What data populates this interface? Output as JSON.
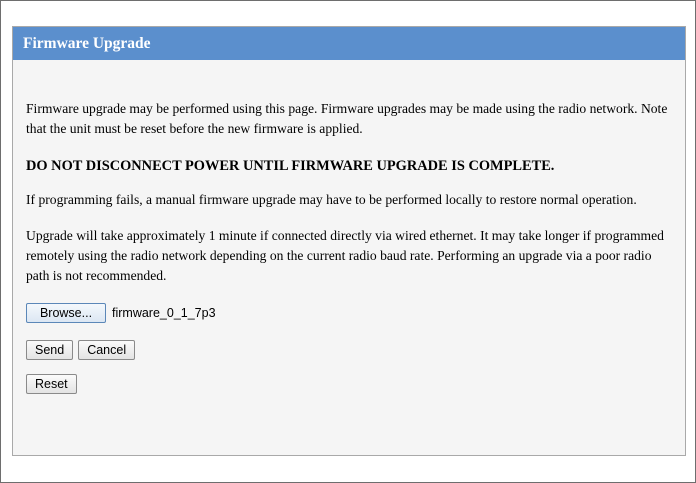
{
  "panel": {
    "title": "Firmware Upgrade"
  },
  "content": {
    "intro": "Firmware upgrade may be performed using this page. Firmware upgrades may be made using the radio network. Note that the unit must be reset before the new firmware is applied.",
    "warning": "DO NOT DISCONNECT POWER UNTIL FIRMWARE UPGRADE IS COMPLETE.",
    "failure_note": "If programming fails, a manual firmware upgrade may have to be performed locally to restore normal operation.",
    "timing_note": "Upgrade will take approximately 1 minute if connected directly via wired ethernet. It may take longer if programmed remotely using the radio network depending on the current radio baud rate. Performing an upgrade via a poor radio path is not recommended."
  },
  "file_input": {
    "browse_label": "Browse...",
    "selected_file": "firmware_0_1_7p3"
  },
  "actions": {
    "send_label": "Send",
    "cancel_label": "Cancel",
    "reset_label": "Reset"
  }
}
